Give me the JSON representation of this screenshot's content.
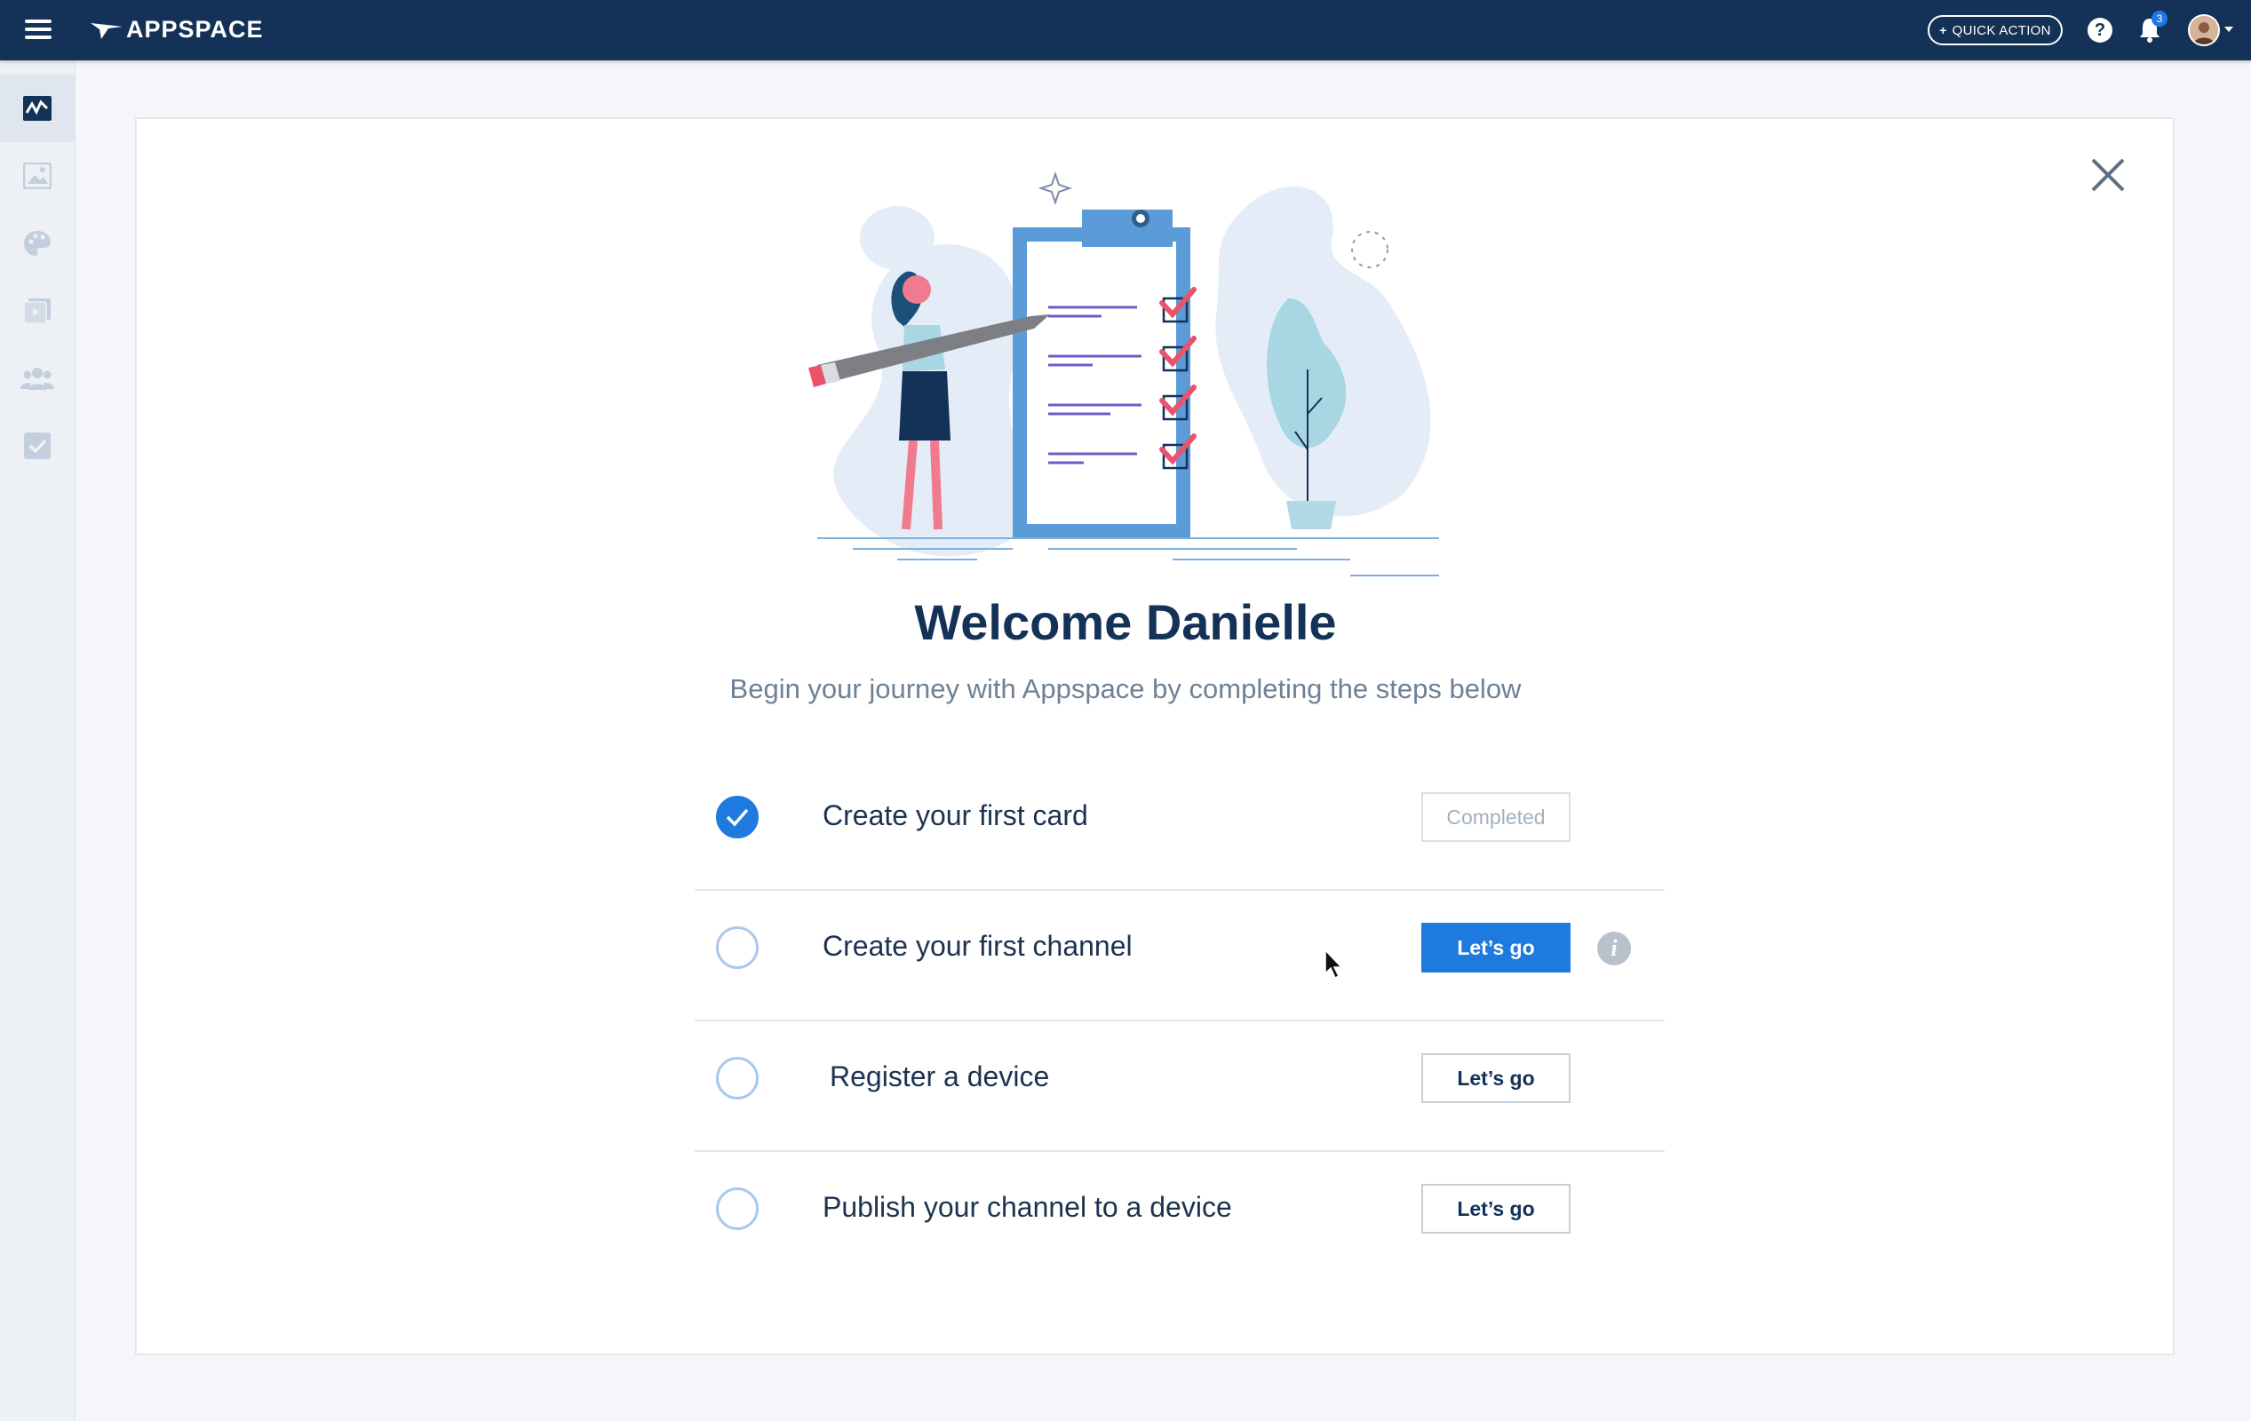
{
  "header": {
    "logo_text": "APPSPACE",
    "quick_action_label": "QUICK ACTION",
    "help_symbol": "?",
    "notification_count": "3",
    "icons": [
      "menu-icon",
      "help-icon",
      "bell-icon",
      "avatar"
    ]
  },
  "sidebar": {
    "items": [
      {
        "icon": "dashboard-icon",
        "active": true
      },
      {
        "icon": "image-icon",
        "active": false
      },
      {
        "icon": "palette-icon",
        "active": false
      },
      {
        "icon": "media-icon",
        "active": false
      },
      {
        "icon": "users-icon",
        "active": false
      },
      {
        "icon": "tasks-icon",
        "active": false
      }
    ]
  },
  "welcome": {
    "title": "Welcome Danielle",
    "subtitle": "Begin your journey with Appspace by completing the steps below"
  },
  "steps": [
    {
      "label": "Create your first card",
      "button": "Completed",
      "done": true
    },
    {
      "label": "Create your first channel",
      "button": "Let’s go",
      "done": false
    },
    {
      "label": "Register a device",
      "button": "Let’s go",
      "done": false
    },
    {
      "label": "Publish your channel to a device",
      "button": "Let’s go",
      "done": false
    }
  ],
  "info_symbol": "i",
  "colors": {
    "topbar": "#143257",
    "accent": "#1f7ae0",
    "title": "#143257",
    "subtitle": "#6e8195"
  }
}
